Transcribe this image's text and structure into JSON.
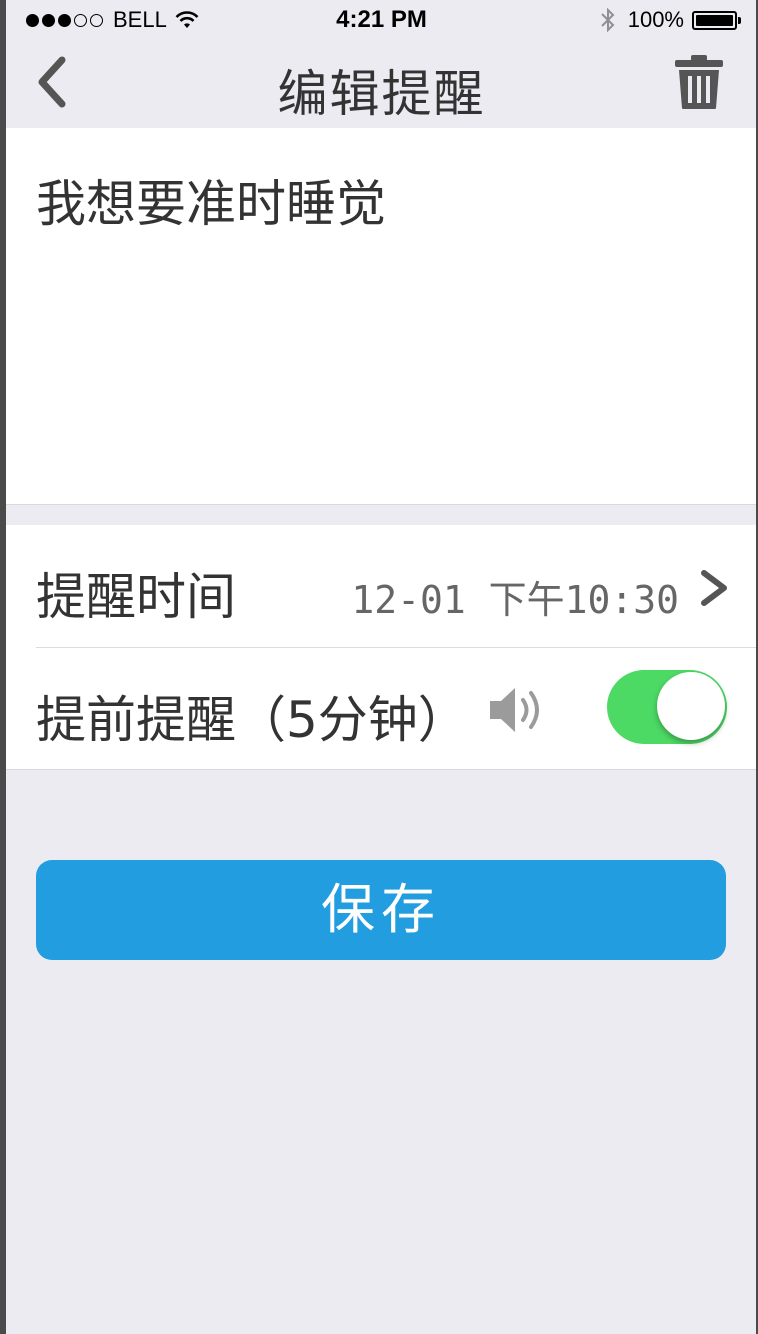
{
  "status_bar": {
    "carrier": "BELL",
    "time": "4:21 PM",
    "battery": "100%",
    "signal_bars": 3,
    "signal_total": 5
  },
  "nav": {
    "title": "编辑提醒",
    "back_icon": "chevron-left-icon",
    "delete_icon": "trash-icon"
  },
  "note": {
    "text": "我想要准时睡觉"
  },
  "settings": {
    "remind_time_label": "提醒时间",
    "remind_time_value": "12-01 下午10:30",
    "advance_label": "提前提醒（5分钟）",
    "advance_enabled": true
  },
  "save_label": "保存",
  "colors": {
    "background": "#ecebf1",
    "text_primary": "#333333",
    "text_secondary": "#666666",
    "accent": "#229de0",
    "toggle_on": "#4cd964"
  }
}
